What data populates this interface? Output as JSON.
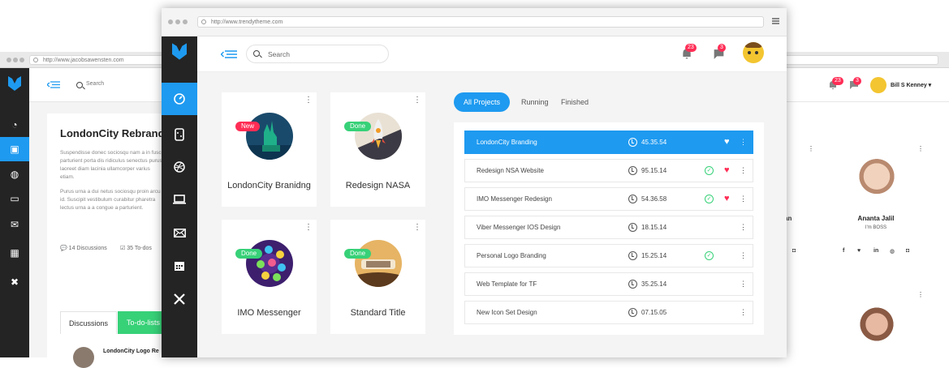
{
  "back_left": {
    "url": "http://www.jacobsawensten.com",
    "search_placeholder": "Search",
    "title": "LondonCity Rebranding",
    "para1": "Suspendisse donec sociosqu nam a in fusce parturient porta dis ridiculus senectus purus laoreet diam lacinia ullamcorper varius etiam.",
    "para2": "Purus urna a dui netus sociosqu proin arcu id. Suscipit vestibulum curabitur pharetra lectus urna a a congue a parturient.",
    "discussions": "14 Discussions",
    "todos": "35 To-dos",
    "tab_discussions": "Discussions",
    "tab_todo": "To-do-lists",
    "list_item": "LondonCity Logo Re"
  },
  "back_right": {
    "badge_notifications": "23",
    "badge_messages": "3",
    "user_name": "Bill S Kenney",
    "member1_name_fragment": "an",
    "member2_name": "Ananta Jalil",
    "member2_role": "I'm BOSS"
  },
  "front": {
    "url": "http://www.trendytheme.com",
    "search_placeholder": "Search",
    "badge_notifications": "23",
    "badge_messages": "3",
    "projects": [
      {
        "title": "LondonCity Branidng",
        "tag": "New",
        "tag_color": "#ff2d55"
      },
      {
        "title": "Redesign NASA",
        "tag": "Done",
        "tag_color": "#37d178"
      },
      {
        "title": "IMO Messenger",
        "tag": "Done",
        "tag_color": "#37d178"
      },
      {
        "title": "Standard Title",
        "tag": "Done",
        "tag_color": "#37d178"
      }
    ],
    "tabs": [
      "All Projects",
      "Running",
      "Finished"
    ],
    "rows": [
      {
        "name": "LondonCity Branding",
        "time": "45.35.54",
        "done": false,
        "fav": true
      },
      {
        "name": "Redesign NSA Website",
        "time": "95.15.14",
        "done": true,
        "fav": true
      },
      {
        "name": "IMO Messenger Redesign",
        "time": "54.36.58",
        "done": true,
        "fav": true
      },
      {
        "name": "Viber Messenger IOS Design",
        "time": "18.15.14",
        "done": false,
        "fav": false
      },
      {
        "name": "Personal Logo Branding",
        "time": "15.25.14",
        "done": true,
        "fav": false
      },
      {
        "name": "Web Template for TF",
        "time": "35.25.14",
        "done": false,
        "fav": false
      },
      {
        "name": "New Icon Set Design",
        "time": "07.15.05",
        "done": false,
        "fav": false
      }
    ]
  },
  "colors": {
    "accent": "#1e9af0",
    "green": "#37d178",
    "red": "#ff2d55",
    "sidebar": "#242424"
  },
  "icons": [
    "logo-icon",
    "dashboard-icon",
    "projects-icon",
    "dribbble-icon",
    "laptop-icon",
    "mail-icon",
    "calendar-icon",
    "tools-icon",
    "bell-icon",
    "chat-icon",
    "clock-icon",
    "heart-icon",
    "check-icon",
    "kebab-icon",
    "search-icon",
    "menu-back-icon"
  ]
}
